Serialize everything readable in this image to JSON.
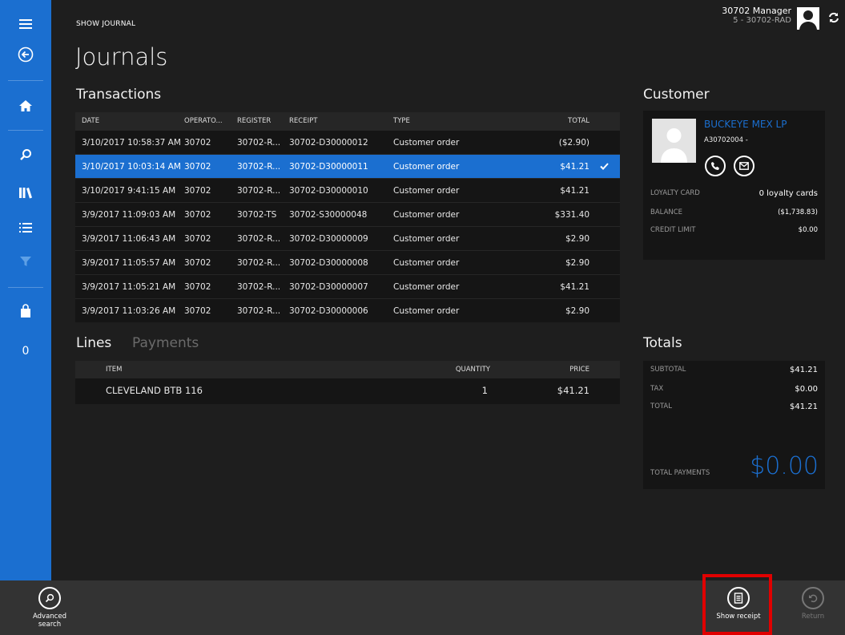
{
  "header": {
    "breadcrumb": "SHOW JOURNAL",
    "title": "Journals",
    "user_name": "30702 Manager",
    "user_store": "5 - 30702-RAD"
  },
  "sidebar": {
    "cart_count": "0"
  },
  "transactions": {
    "title": "Transactions",
    "columns": [
      "DATE",
      "OPERATO...",
      "REGISTER",
      "RECEIPT",
      "TYPE",
      "TOTAL"
    ],
    "rows": [
      {
        "date": "3/10/2017 10:58:37 AM",
        "operator": "30702",
        "register": "30702-R...",
        "receipt": "30702-D30000012",
        "type": "Customer order",
        "total": "($2.90)",
        "selected": false
      },
      {
        "date": "3/10/2017 10:03:14 AM",
        "operator": "30702",
        "register": "30702-R...",
        "receipt": "30702-D30000011",
        "type": "Customer order",
        "total": "$41.21",
        "selected": true
      },
      {
        "date": "3/10/2017 9:41:15 AM",
        "operator": "30702",
        "register": "30702-R...",
        "receipt": "30702-D30000010",
        "type": "Customer order",
        "total": "$41.21",
        "selected": false
      },
      {
        "date": "3/9/2017 11:09:03 AM",
        "operator": "30702",
        "register": "30702-TS",
        "receipt": "30702-S30000048",
        "type": "Customer order",
        "total": "$331.40",
        "selected": false
      },
      {
        "date": "3/9/2017 11:06:43 AM",
        "operator": "30702",
        "register": "30702-R...",
        "receipt": "30702-D30000009",
        "type": "Customer order",
        "total": "$2.90",
        "selected": false
      },
      {
        "date": "3/9/2017 11:05:57 AM",
        "operator": "30702",
        "register": "30702-R...",
        "receipt": "30702-D30000008",
        "type": "Customer order",
        "total": "$2.90",
        "selected": false
      },
      {
        "date": "3/9/2017 11:05:21 AM",
        "operator": "30702",
        "register": "30702-R...",
        "receipt": "30702-D30000007",
        "type": "Customer order",
        "total": "$41.21",
        "selected": false
      },
      {
        "date": "3/9/2017 11:03:26 AM",
        "operator": "30702",
        "register": "30702-R...",
        "receipt": "30702-D30000006",
        "type": "Customer order",
        "total": "$2.90",
        "selected": false
      }
    ]
  },
  "lines": {
    "tab_lines": "Lines",
    "tab_payments": "Payments",
    "columns": [
      "ITEM",
      "QUANTITY",
      "PRICE"
    ],
    "rows": [
      {
        "item": "CLEVELAND BTB 116",
        "quantity": "1",
        "price": "$41.21"
      }
    ]
  },
  "customer": {
    "title": "Customer",
    "name": "BUCKEYE MEX LP",
    "account": "A30702004  -",
    "loyalty_label": "LOYALTY CARD",
    "loyalty_value": "0 loyalty cards",
    "balance_label": "BALANCE",
    "balance_value": "($1,738.83)",
    "credit_label": "CREDIT LIMIT",
    "credit_value": "$0.00"
  },
  "totals": {
    "title": "Totals",
    "subtotal_label": "SUBTOTAL",
    "subtotal_value": "$41.21",
    "tax_label": "TAX",
    "tax_value": "$0.00",
    "total_label": "TOTAL",
    "total_value": "$41.21",
    "payments_label": "TOTAL PAYMENTS",
    "payments_value": "$0.00"
  },
  "appbar": {
    "advanced_search": "Advanced search",
    "show_receipt": "Show receipt",
    "return": "Return"
  },
  "colors": {
    "accent": "#1b6fd0",
    "highlight": "#e00000",
    "background": "#1e1e1e"
  }
}
